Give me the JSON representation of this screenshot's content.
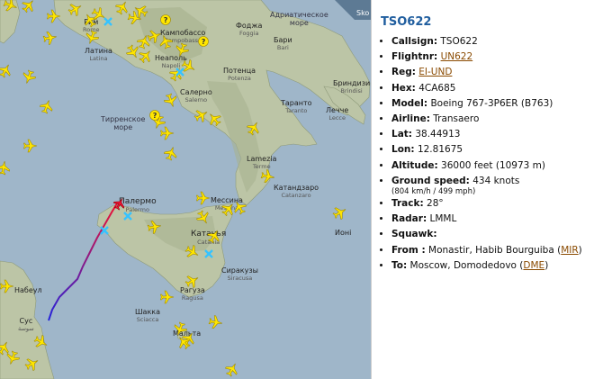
{
  "map": {
    "seas": [
      {
        "id": "adriatic",
        "ru": "Адриатическое",
        "ru2": "море"
      },
      {
        "id": "tyrrhenian",
        "ru": "Тирренское",
        "ru2": "море"
      }
    ],
    "cities": [
      {
        "id": "rome",
        "ru": "Рим",
        "lat": "Rome"
      },
      {
        "id": "latina",
        "ru": "Латина",
        "lat": "Latina"
      },
      {
        "id": "campobasso",
        "ru": "Кампобассо",
        "lat": "Campobasso"
      },
      {
        "id": "foggia",
        "ru": "Фоджа",
        "lat": "Foggia"
      },
      {
        "id": "bari",
        "ru": "Бари",
        "lat": "Bari"
      },
      {
        "id": "naples",
        "ru": "Неаполь",
        "lat": "Napoli"
      },
      {
        "id": "potenza",
        "ru": "Потенца",
        "lat": "Potenza"
      },
      {
        "id": "salerno",
        "ru": "Салерно",
        "lat": "Salerno"
      },
      {
        "id": "brindisi",
        "ru": "Бриндизи",
        "lat": "Brindisi"
      },
      {
        "id": "taranto",
        "ru": "Таранто",
        "lat": "Taranto"
      },
      {
        "id": "lecce",
        "ru": "Лечче",
        "lat": "Lecce"
      },
      {
        "id": "lamezia",
        "ru": "Lamezia",
        "lat": "Terme"
      },
      {
        "id": "catanzaro",
        "ru": "Катандзаро",
        "lat": "Catanzaro"
      },
      {
        "id": "messina",
        "ru": "Мессина",
        "lat": "Messina"
      },
      {
        "id": "palermo",
        "ru": "Палермо",
        "lat": "Palermo"
      },
      {
        "id": "catania",
        "ru": "Катанья",
        "lat": "Catania"
      },
      {
        "id": "syracuse",
        "ru": "Сиракузы",
        "lat": "Siracusa"
      },
      {
        "id": "ragusa",
        "ru": "Рагуза",
        "lat": "Ragusa"
      },
      {
        "id": "sciacca",
        "ru": "Шакка",
        "lat": "Sciacca"
      },
      {
        "id": "nabeul",
        "ru": "Набеул",
        "lat": ""
      },
      {
        "id": "sousse",
        "ru": "Сус",
        "lat": "سوسة"
      },
      {
        "id": "ioni",
        "ru": "Ионі",
        "lat": ""
      },
      {
        "id": "malta",
        "ru": "Мальта",
        "lat": ""
      }
    ],
    "corner_text": "Sko",
    "accent_track_start": "#2222dd",
    "accent_track_end": "#ee1133",
    "plane_color": "#ffe600",
    "plane_outline": "#a08a00",
    "airport_marker_color": "#35c3ff",
    "unknown_marker_color": "#ffe600"
  },
  "panel": {
    "callsign_title": "TSO622",
    "rows": [
      {
        "label": "Callsign:",
        "value": "TSO622"
      },
      {
        "label": "Flightnr:",
        "link": "UN622"
      },
      {
        "label": "Reg:",
        "link": "EI-UND"
      },
      {
        "label": "Hex:",
        "value": "4CA685"
      },
      {
        "label": "Model:",
        "value": "Boeing 767-3P6ER (B763)"
      },
      {
        "label": "Airline:",
        "value": "Transaero"
      },
      {
        "label": "Lat:",
        "value": "38.44913"
      },
      {
        "label": "Lon:",
        "value": "12.81675"
      },
      {
        "label": "Altitude:",
        "value": "36000 feet (10973 m)"
      },
      {
        "label": "Ground speed:",
        "value": "434 knots",
        "sub": "(804 km/h / 499 mph)"
      },
      {
        "label": "Track:",
        "value": "28°"
      },
      {
        "label": "Radar:",
        "value": "LMML"
      },
      {
        "label": "Squawk:",
        "value": ""
      },
      {
        "label": "From :",
        "value": "Monastir, Habib Bourguiba (",
        "link": "MIR",
        "after": ")"
      },
      {
        "label": "To:",
        "value": "Moscow, Domodedovo (",
        "link": "DME",
        "after": ")"
      }
    ]
  }
}
